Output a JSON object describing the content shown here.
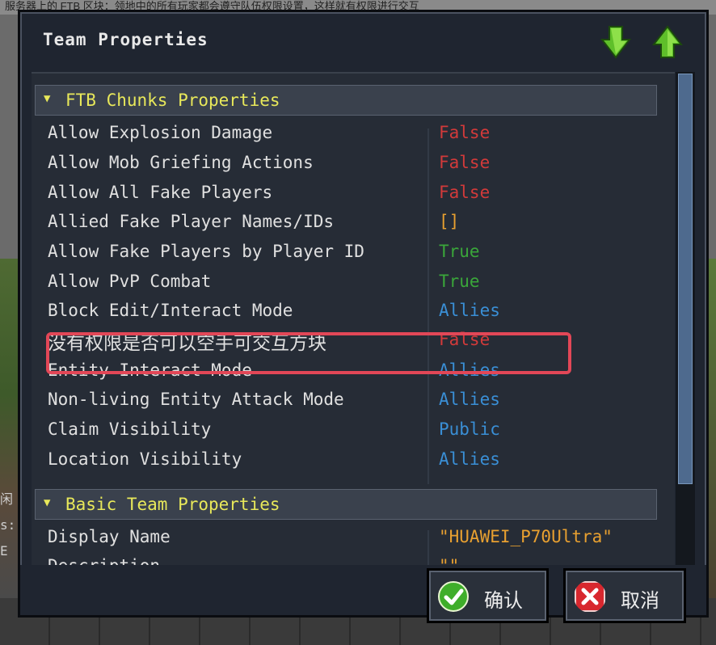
{
  "background": {
    "top_text": "服务器上的 FTB 区块：领地中的所有玩家都会遵守队伍权限设置，这样就有权限进行交互",
    "side_texts": [
      "闲",
      "s:",
      "E"
    ]
  },
  "window": {
    "title": "Team Properties",
    "down_icon": "green-down-arrow-icon",
    "up_icon": "green-up-arrow-icon"
  },
  "sections": [
    {
      "label": "FTB Chunks Properties",
      "rows": [
        {
          "name": "Allow Explosion Damage",
          "value": "False",
          "color": "#d23a3a"
        },
        {
          "name": "Allow Mob Griefing Actions",
          "value": "False",
          "color": "#d23a3a"
        },
        {
          "name": "Allow All Fake Players",
          "value": "False",
          "color": "#d23a3a"
        },
        {
          "name": "Allied Fake Player Names/IDs",
          "value": "[]",
          "color": "#e8a030"
        },
        {
          "name": "Allow Fake Players by Player ID",
          "value": "True",
          "color": "#3aa63a"
        },
        {
          "name": "Allow PvP Combat",
          "value": "True",
          "color": "#3aa63a"
        },
        {
          "name": "Block Edit/Interact Mode",
          "value": "Allies",
          "color": "#3a8fd6"
        },
        {
          "name": "没有权限是否可以空手可交互方块",
          "value": "False",
          "color": "#d23a3a"
        },
        {
          "name": "Entity Interact Mode",
          "value": "Allies",
          "color": "#3a8fd6"
        },
        {
          "name": "Non-living Entity Attack Mode",
          "value": "Allies",
          "color": "#3a8fd6"
        },
        {
          "name": "Claim Visibility",
          "value": "Public",
          "color": "#3a8fd6"
        },
        {
          "name": "Location Visibility",
          "value": "Allies",
          "color": "#3a8fd6"
        }
      ]
    },
    {
      "label": "Basic Team Properties",
      "rows": [
        {
          "name": "Display Name",
          "value": "\"HUAWEI_P70Ultra\"",
          "color": "#e8a030"
        },
        {
          "name": "Description",
          "value": "\"\"",
          "color": "#e8a030"
        }
      ]
    }
  ],
  "buttons": {
    "accept_label": "确认",
    "cancel_label": "取消"
  },
  "colors": {
    "header_text": "#e8e85a",
    "highlight_border": "#e24757",
    "accept_icon": "#3fae2a",
    "cancel_icon": "#d8272e"
  }
}
